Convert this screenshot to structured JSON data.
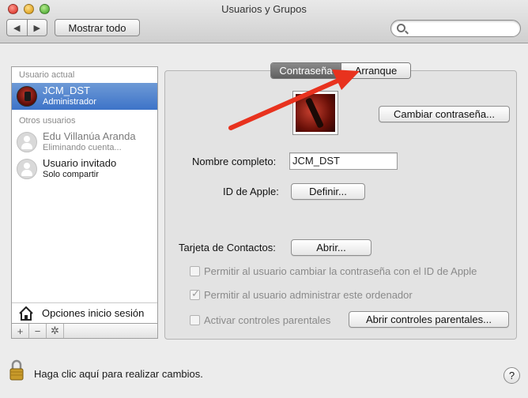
{
  "window": {
    "title": "Usuarios y Grupos"
  },
  "toolbar": {
    "back_glyph": "◀",
    "forward_glyph": "▶",
    "show_all_label": "Mostrar todo",
    "search_placeholder": ""
  },
  "sidebar": {
    "current_header": "Usuario actual",
    "current_user": {
      "name": "JCM_DST",
      "role": "Administrador"
    },
    "others_header": "Otros usuarios",
    "other_users": [
      {
        "name": "Edu Villanúa Aranda",
        "role": "Eliminando cuenta..."
      },
      {
        "name": "Usuario invitado",
        "role": "Solo compartir"
      }
    ],
    "login_options_label": "Opciones inicio sesión",
    "add_glyph": "+",
    "remove_glyph": "−",
    "action_glyph": "✲"
  },
  "tabs": {
    "active": "Contraseña",
    "inactive": "Arranque"
  },
  "form": {
    "change_password_button": "Cambiar contraseña...",
    "full_name_label": "Nombre completo:",
    "full_name_value": "JCM_DST",
    "apple_id_label": "ID de Apple:",
    "apple_id_button": "Definir...",
    "contacts_label": "Tarjeta de Contactos:",
    "contacts_button": "Abrir...",
    "checkbox_apple_id": {
      "label": "Permitir al usuario cambiar la contraseña con el ID de Apple",
      "checked": false
    },
    "checkbox_admin": {
      "label": "Permitir al usuario administrar este ordenador",
      "checked": true
    },
    "checkbox_parental": {
      "label": "Activar controles parentales",
      "checked": false
    },
    "parental_button": "Abrir controles parentales..."
  },
  "footer": {
    "lock_text": "Haga clic aquí para realizar cambios.",
    "help_glyph": "?"
  },
  "colors": {
    "selection": "#3d73c8",
    "annotation_arrow": "#e8321e"
  },
  "icons": [
    "lock-icon",
    "house-icon",
    "search-icon",
    "help-icon",
    "gear-icon"
  ]
}
